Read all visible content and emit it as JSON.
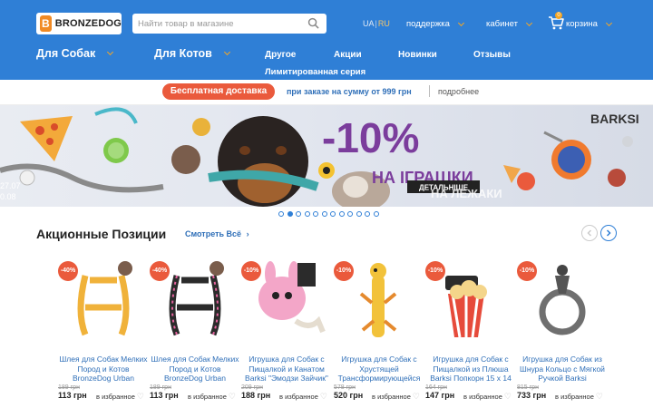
{
  "header": {
    "logo_text": "BRONZEDOG",
    "search_placeholder": "Найти товар в магазине",
    "lang_ua": "UA",
    "lang_sep": "|",
    "lang_ru": "RU",
    "support": "поддержка",
    "cabinet": "кабинет",
    "cart": "корзина",
    "cart_count": "0"
  },
  "mainnav": {
    "dogs": "Для Собак",
    "cats": "Для Котов",
    "other": "Другое",
    "promos": "Акции",
    "news": "Новинки",
    "reviews": "Отзывы",
    "limited": "Лимитированная серия"
  },
  "delivery": {
    "badge": "Бесплатная доставка",
    "text": "при заказе на сумму от 999 грн",
    "more": "подробнее"
  },
  "banner": {
    "discount": "-10%",
    "headline": "НА ІГРАШКИ",
    "cta": "ДЕТАЛЬНІШЕ",
    "brand": "BARKSI",
    "ghost_text": "НА ЛЕЖАКИ",
    "date_left_1": "27.07",
    "date_left_2": "0.08"
  },
  "carousel": {
    "slide_count": 12,
    "active_index": 1
  },
  "section": {
    "title": "Акционные Позиции",
    "see_all": "Смотреть Всё"
  },
  "products": [
    {
      "discount": "-40%",
      "name": "Шлея для Собак Мелких Пород и Котов BronzeDog Urban",
      "old_price": "189 грн",
      "price": "113 грн",
      "fav": "в избранное"
    },
    {
      "discount": "-40%",
      "name": "Шлея для Собак Мелких Пород и Котов BronzeDog Urban",
      "old_price": "189 грн",
      "price": "113 грн",
      "fav": "в избранное"
    },
    {
      "discount": "-10%",
      "name": "Игрушка для Собак с Пищалкой и Канатом Barksi \"Эмодзи Зайчик\"",
      "old_price": "209 грн",
      "price": "188 грн",
      "fav": "в избранное"
    },
    {
      "discount": "-10%",
      "name": "Игрушка для Собак с Хрустящей Трансформирующейся",
      "old_price": "578 грн",
      "price": "520 грн",
      "fav": "в избранное"
    },
    {
      "discount": "-10%",
      "name": "Игрушка для Собак с Пищалкой из Плюша Barksi Попкорн 15 х 14",
      "old_price": "164 грн",
      "price": "147 грн",
      "fav": "в избранное"
    },
    {
      "discount": "-10%",
      "name": "Игрушка для Собак из Шнура Кольцо с Мягкой Ручкой Barksi",
      "old_price": "815 грн",
      "price": "733 грн",
      "fav": "в избранное"
    }
  ],
  "colors": {
    "header_bg": "#2f7fd6",
    "accent": "#f6a623",
    "discount_red": "#ea5a3c",
    "link_blue": "#2f6fb8"
  }
}
